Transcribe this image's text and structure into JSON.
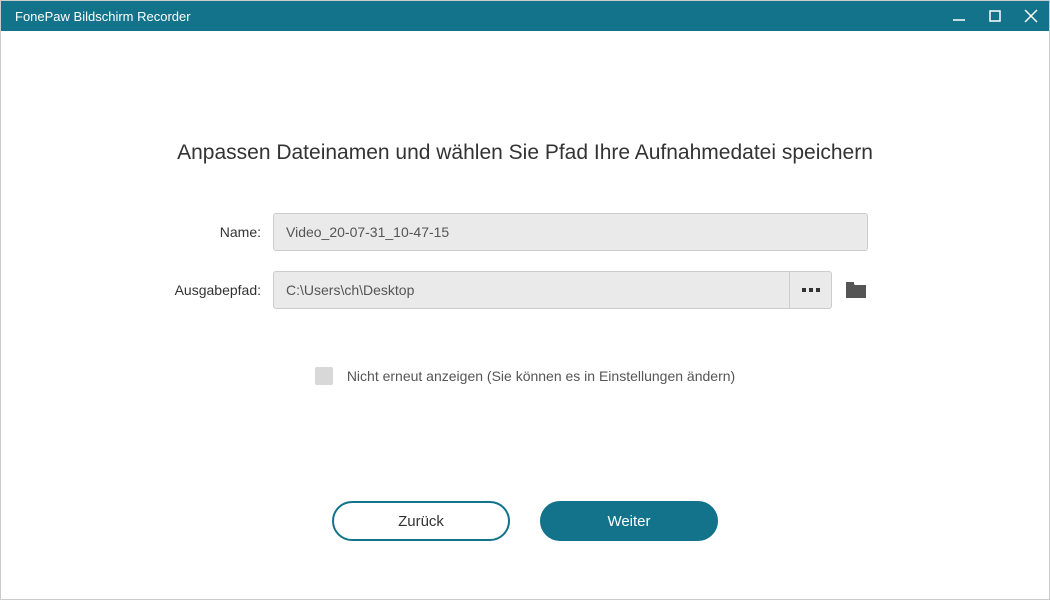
{
  "titlebar": {
    "title": "FonePaw Bildschirm Recorder"
  },
  "heading": "Anpassen Dateinamen und wählen Sie Pfad Ihre Aufnahmedatei speichern",
  "form": {
    "name_label": "Name:",
    "name_value": "Video_20-07-31_10-47-15",
    "path_label": "Ausgabepfad:",
    "path_value": "C:\\Users\\ch\\Desktop"
  },
  "checkbox": {
    "label": "Nicht erneut anzeigen (Sie können es in Einstellungen ändern)",
    "checked": false
  },
  "buttons": {
    "back": "Zurück",
    "next": "Weiter"
  },
  "colors": {
    "accent": "#12738a"
  }
}
